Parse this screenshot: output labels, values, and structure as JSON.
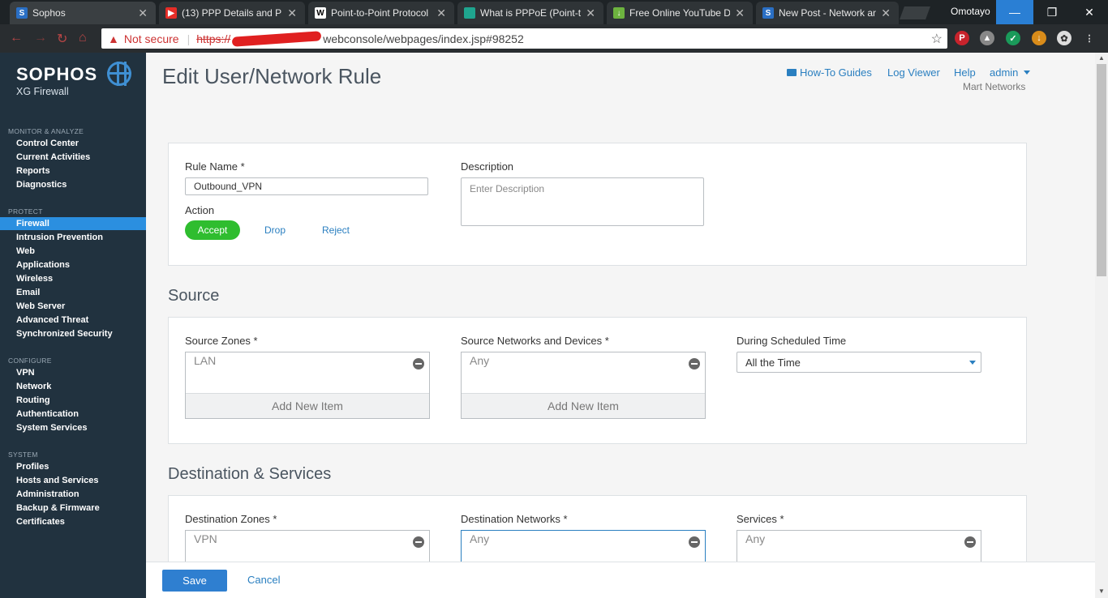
{
  "browser": {
    "tabs": [
      {
        "title": "Sophos",
        "favicon": "S"
      },
      {
        "title": "(13) PPP Details and PP...",
        "favicon": "▶"
      },
      {
        "title": "Point-to-Point Protocol",
        "favicon": "W"
      },
      {
        "title": "What is PPPoE (Point-t",
        "favicon": ""
      },
      {
        "title": "Free Online YouTube D",
        "favicon": "↓"
      },
      {
        "title": "New Post - Network an",
        "favicon": "S"
      }
    ],
    "user": "Omotayo",
    "address": {
      "not_secure": "Not secure",
      "scheme": "https://",
      "path": "webconsole/webpages/index.jsp#98252"
    }
  },
  "sidebar": {
    "brand": "SOPHOS",
    "product": "XG Firewall",
    "sections": [
      {
        "title": "MONITOR & ANALYZE",
        "items": [
          "Control Center",
          "Current Activities",
          "Reports",
          "Diagnostics"
        ]
      },
      {
        "title": "PROTECT",
        "items": [
          "Firewall",
          "Intrusion Prevention",
          "Web",
          "Applications",
          "Wireless",
          "Email",
          "Web Server",
          "Advanced Threat",
          "Synchronized Security"
        ]
      },
      {
        "title": "CONFIGURE",
        "items": [
          "VPN",
          "Network",
          "Routing",
          "Authentication",
          "System Services"
        ]
      },
      {
        "title": "SYSTEM",
        "items": [
          "Profiles",
          "Hosts and Services",
          "Administration",
          "Backup & Firmware",
          "Certificates"
        ]
      }
    ],
    "active_item": "Firewall"
  },
  "header": {
    "title": "Edit User/Network Rule",
    "how_to": "How-To Guides",
    "log_viewer": "Log Viewer",
    "help": "Help",
    "admin": "admin",
    "org": "Mart Networks"
  },
  "rule": {
    "name_label": "Rule Name *",
    "name_value": "Outbound_VPN",
    "description_label": "Description",
    "description_placeholder": "Enter Description",
    "action_label": "Action",
    "actions": [
      "Accept",
      "Drop",
      "Reject"
    ],
    "selected_action": "Accept"
  },
  "source": {
    "heading": "Source",
    "zones_label": "Source Zones *",
    "zones_value": "LAN",
    "networks_label": "Source Networks and Devices *",
    "networks_value": "Any",
    "schedule_label": "During Scheduled Time",
    "schedule_value": "All the Time",
    "add_new": "Add New Item"
  },
  "destination": {
    "heading": "Destination & Services",
    "zones_label": "Destination Zones *",
    "zones_value": "VPN",
    "networks_label": "Destination Networks *",
    "networks_value": "Any",
    "services_label": "Services *",
    "services_value": "Any"
  },
  "footer": {
    "save": "Save",
    "cancel": "Cancel"
  },
  "colors": {
    "sidebar": "#21323f",
    "active_nav": "#2b8fe0",
    "accept": "#2fbd2f",
    "link": "#2a7fc0"
  }
}
